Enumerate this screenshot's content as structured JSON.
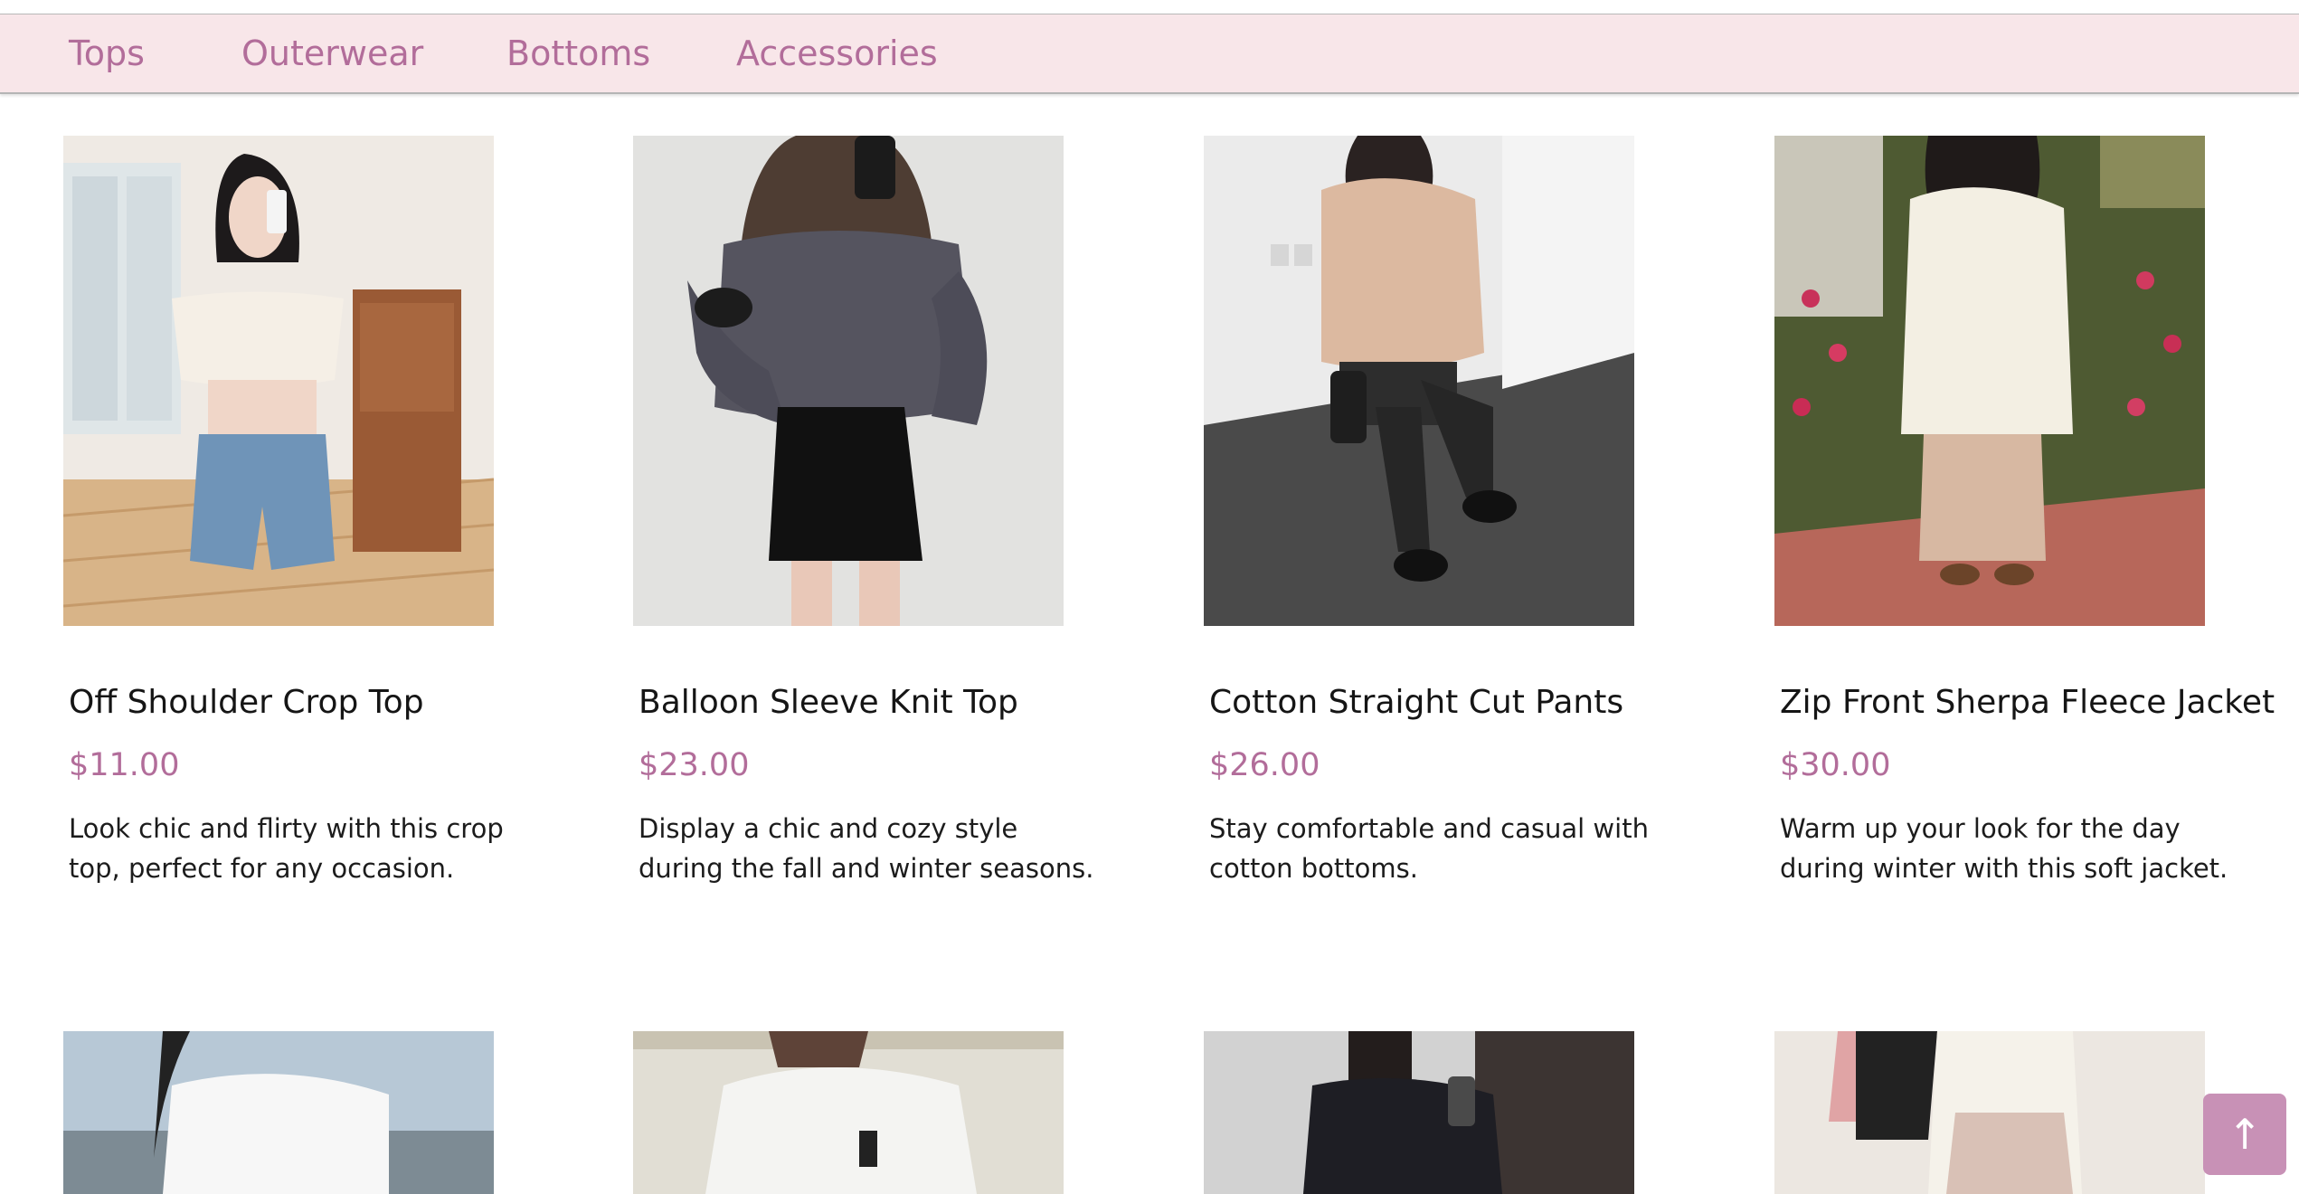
{
  "nav": {
    "items": [
      "Tops",
      "Outerwear",
      "Bottoms",
      "Accessories"
    ]
  },
  "products": [
    {
      "name": "Off Shoulder Crop Top",
      "price": "$11.00",
      "description": "Look chic and flirty with this crop top, perfect for any occasion."
    },
    {
      "name": "Balloon Sleeve Knit Top",
      "price": "$23.00",
      "description": "Display a chic and cozy style during the fall and winter seasons."
    },
    {
      "name": "Cotton Straight Cut Pants",
      "price": "$26.00",
      "description": "Stay comfortable and casual with cotton bottoms."
    },
    {
      "name": "Zip Front Sherpa Fleece Jacket",
      "price": "$30.00",
      "description": "Warm up your look for the day during winter with this soft jacket."
    }
  ],
  "scroll_top_icon": "arrow-up-icon",
  "colors": {
    "nav_bg": "#f8e6e9",
    "accent": "#b26d9a",
    "button": "#c891b6"
  }
}
